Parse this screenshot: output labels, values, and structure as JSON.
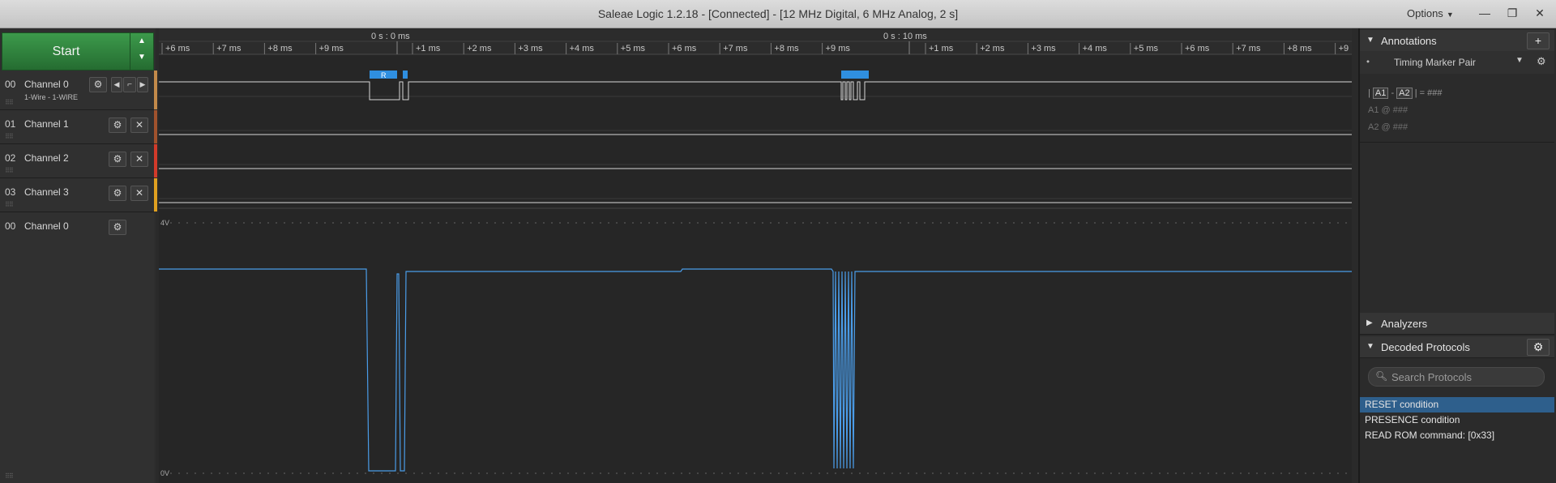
{
  "window": {
    "title": "Saleae Logic 1.2.18 - [Connected] - [12 MHz Digital, 6 MHz Analog, 2 s]",
    "options_label": "Options",
    "minimize": "—",
    "restore": "❐",
    "close": "✕"
  },
  "toolbar": {
    "start_label": "Start",
    "up_icon": "▲",
    "down_icon": "▼"
  },
  "channels": [
    {
      "num": "00",
      "name": "Channel 0",
      "sub": "1-Wire - 1-WIRE",
      "color": "#c28a4a"
    },
    {
      "num": "01",
      "name": "Channel 1",
      "color": "#a0522d"
    },
    {
      "num": "02",
      "name": "Channel 2",
      "color": "#d23a2a"
    },
    {
      "num": "03",
      "name": "Channel 3",
      "color": "#e0a020"
    },
    {
      "num": "00",
      "name": "Channel 0"
    }
  ],
  "timeline": {
    "marker_left": "0 s : 0 ms",
    "marker_right": "0 s : 10 ms",
    "ticks_left": [
      "+6 ms",
      "+7 ms",
      "+8 ms",
      "+9 ms"
    ],
    "ticks_mid": [
      "+1 ms",
      "+2 ms",
      "+3 ms",
      "+4 ms",
      "+5 ms",
      "+6 ms",
      "+7 ms",
      "+8 ms",
      "+9 ms"
    ],
    "ticks_right": [
      "+1 ms",
      "+2 ms",
      "+3 ms",
      "+4 ms",
      "+5 ms",
      "+6 ms",
      "+7 ms",
      "+8 ms",
      "+9"
    ],
    "reset_label": "R"
  },
  "analog": {
    "top_label": "4V",
    "bottom_label": "0V",
    "trace_color": "#4a9ce8"
  },
  "annotations": {
    "header": "Annotations",
    "add_icon": "+",
    "marker_pair": "Timing Marker Pair",
    "a1": "A1",
    "a2": "A2",
    "diff_value": "= ###",
    "a1_line": "A1  @  ###",
    "a2_line": "A2  @  ###"
  },
  "analyzers": {
    "header": "Analyzers"
  },
  "decoded": {
    "header": "Decoded Protocols",
    "search_placeholder": "Search Protocols",
    "items": [
      {
        "label": "RESET condition",
        "selected": true
      },
      {
        "label": "PRESENCE condition",
        "selected": false
      },
      {
        "label": "READ ROM command: [0x33]",
        "selected": false
      }
    ]
  },
  "colors": {
    "start_green": "#2f8a3e",
    "highlight_blue": "#2e5f8c",
    "decode_bubble": "#2f8fe0"
  }
}
